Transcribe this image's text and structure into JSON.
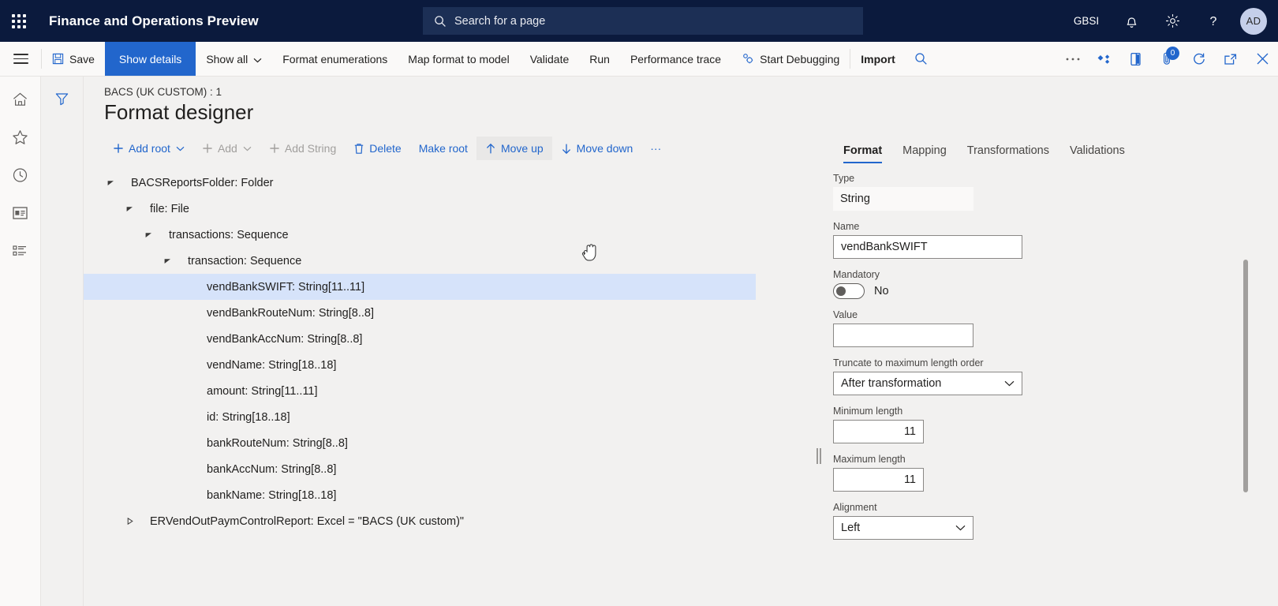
{
  "topnav": {
    "waffle_icon": "app-launcher-icon",
    "app_title": "Finance and Operations Preview",
    "search": {
      "placeholder": "Search for a page",
      "icon": "search-icon"
    },
    "company": "GBSI",
    "notifications_icon": "bell-icon",
    "settings_icon": "gear-icon",
    "help_icon": "question-mark-icon",
    "avatar_initials": "AD"
  },
  "commandbar": {
    "menu_icon": "hamburger-icon",
    "save_label": "Save",
    "save_icon": "save-disk-icon",
    "show_details_label": "Show details",
    "show_all_label": "Show all",
    "format_enumerations_label": "Format enumerations",
    "map_format_to_model_label": "Map format to model",
    "validate_label": "Validate",
    "run_label": "Run",
    "performance_trace_label": "Performance trace",
    "start_debugging_label": "Start Debugging",
    "start_debugging_icon": "debug-gear-icon",
    "import_label": "Import",
    "search_icon": "search-icon",
    "overflow_icon": "ellipsis-icon",
    "diamond_icon": "diamond-cluster-icon",
    "office_icon": "office-app-icon",
    "attachments_icon": "attachment-icon",
    "attachments_count": "0",
    "refresh_icon": "refresh-icon",
    "popout_icon": "open-in-new-window-icon",
    "close_icon": "close-x-icon"
  },
  "leftrail": {
    "items": [
      {
        "icon": "home-icon",
        "name": "home"
      },
      {
        "icon": "star-icon",
        "name": "favorites"
      },
      {
        "icon": "clock-icon",
        "name": "recent"
      },
      {
        "icon": "workspace-icon",
        "name": "workspaces"
      },
      {
        "icon": "modules-list-icon",
        "name": "modules"
      }
    ],
    "filter_icon": "filter-funnel-icon"
  },
  "page": {
    "breadcrumb": "BACS (UK CUSTOM) : 1",
    "title": "Format designer"
  },
  "actions": [
    {
      "label": "Add root",
      "icon": "plus-icon",
      "chevron": true,
      "disabled": false,
      "hovered": false
    },
    {
      "label": "Add",
      "icon": "plus-icon",
      "chevron": true,
      "disabled": true,
      "hovered": false
    },
    {
      "label": "Add String",
      "icon": "plus-icon",
      "chevron": false,
      "disabled": true,
      "hovered": false
    },
    {
      "label": "Delete",
      "icon": "trash-icon",
      "chevron": false,
      "disabled": false,
      "hovered": false
    },
    {
      "label": "Make root",
      "icon": "",
      "chevron": false,
      "disabled": false,
      "hovered": false
    },
    {
      "label": "Move up",
      "icon": "arrow-up-icon",
      "chevron": false,
      "disabled": false,
      "hovered": true
    },
    {
      "label": "Move down",
      "icon": "arrow-down-icon",
      "chevron": false,
      "disabled": false,
      "hovered": false
    },
    {
      "label": "···",
      "icon": "",
      "chevron": false,
      "disabled": false,
      "hovered": false
    }
  ],
  "tree": [
    {
      "label": "BACSReportsFolder: Folder",
      "indent": 0,
      "arrow": "expanded",
      "selected": false
    },
    {
      "label": "file: File",
      "indent": 1,
      "arrow": "expanded",
      "selected": false
    },
    {
      "label": "transactions: Sequence",
      "indent": 2,
      "arrow": "expanded",
      "selected": false
    },
    {
      "label": "transaction: Sequence",
      "indent": 3,
      "arrow": "expanded",
      "selected": false
    },
    {
      "label": "vendBankSWIFT: String[11..11]",
      "indent": 4,
      "arrow": "none",
      "selected": true
    },
    {
      "label": "vendBankRouteNum: String[8..8]",
      "indent": 4,
      "arrow": "none",
      "selected": false
    },
    {
      "label": "vendBankAccNum: String[8..8]",
      "indent": 4,
      "arrow": "none",
      "selected": false
    },
    {
      "label": "vendName: String[18..18]",
      "indent": 4,
      "arrow": "none",
      "selected": false
    },
    {
      "label": "amount: String[11..11]",
      "indent": 4,
      "arrow": "none",
      "selected": false
    },
    {
      "label": "id: String[18..18]",
      "indent": 4,
      "arrow": "none",
      "selected": false
    },
    {
      "label": "bankRouteNum: String[8..8]",
      "indent": 4,
      "arrow": "none",
      "selected": false
    },
    {
      "label": "bankAccNum: String[8..8]",
      "indent": 4,
      "arrow": "none",
      "selected": false
    },
    {
      "label": "bankName: String[18..18]",
      "indent": 4,
      "arrow": "none",
      "selected": false
    },
    {
      "label": "ERVendOutPaymControlReport: Excel = \"BACS (UK custom)\"",
      "indent": 1,
      "arrow": "collapsed",
      "selected": false
    }
  ],
  "panel": {
    "tabs": [
      {
        "label": "Format",
        "active": true
      },
      {
        "label": "Mapping",
        "active": false
      },
      {
        "label": "Transformations",
        "active": false
      },
      {
        "label": "Validations",
        "active": false
      }
    ],
    "fields": {
      "type_label": "Type",
      "type_value": "String",
      "name_label": "Name",
      "name_value": "vendBankSWIFT",
      "mandatory_label": "Mandatory",
      "mandatory_value": "No",
      "value_label": "Value",
      "value_value": "",
      "truncate_label": "Truncate to maximum length order",
      "truncate_value": "After transformation",
      "min_length_label": "Minimum length",
      "min_length_value": "11",
      "max_length_label": "Maximum length",
      "max_length_value": "11",
      "alignment_label": "Alignment",
      "alignment_value": "Left"
    }
  },
  "colors": {
    "nav_bg": "#0b1a3d",
    "accent": "#2266cc",
    "page_bg": "#f2f1f0",
    "selection": "#d6e3fa"
  }
}
